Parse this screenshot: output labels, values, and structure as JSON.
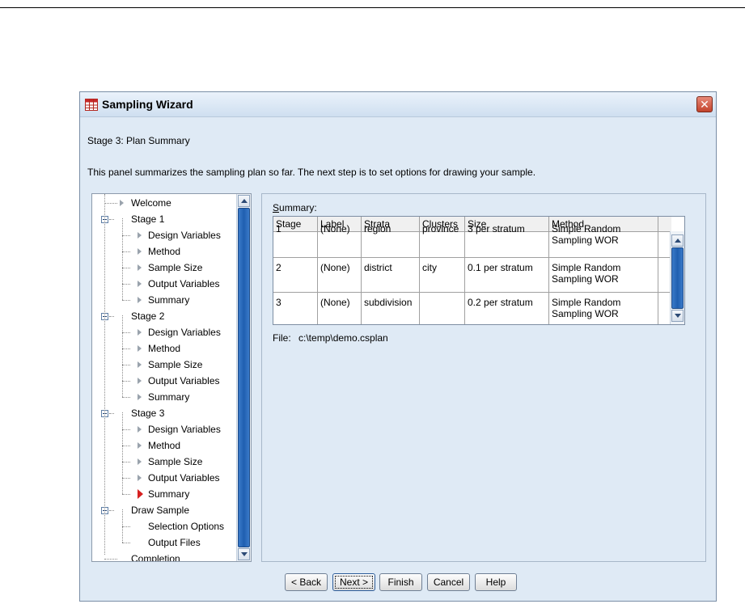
{
  "window": {
    "title": "Sampling Wizard",
    "close_glyph": "✕"
  },
  "stage_title": "Stage 3: Plan Summary",
  "description": "This panel summarizes the sampling plan so far. The next step is to set options for drawing your sample.",
  "tree": {
    "items": [
      {
        "label": "Welcome",
        "level": 0,
        "type": "arrow"
      },
      {
        "label": "Stage 1",
        "level": 0,
        "type": "expander"
      },
      {
        "label": "Design Variables",
        "level": 1,
        "type": "arrow"
      },
      {
        "label": "Method",
        "level": 1,
        "type": "arrow"
      },
      {
        "label": "Sample Size",
        "level": 1,
        "type": "arrow"
      },
      {
        "label": "Output Variables",
        "level": 1,
        "type": "arrow"
      },
      {
        "label": "Summary",
        "level": 1,
        "type": "arrow"
      },
      {
        "label": "Stage 2",
        "level": 0,
        "type": "expander"
      },
      {
        "label": "Design Variables",
        "level": 1,
        "type": "arrow"
      },
      {
        "label": "Method",
        "level": 1,
        "type": "arrow"
      },
      {
        "label": "Sample Size",
        "level": 1,
        "type": "arrow"
      },
      {
        "label": "Output Variables",
        "level": 1,
        "type": "arrow"
      },
      {
        "label": "Summary",
        "level": 1,
        "type": "arrow"
      },
      {
        "label": "Stage 3",
        "level": 0,
        "type": "expander"
      },
      {
        "label": "Design Variables",
        "level": 1,
        "type": "arrow"
      },
      {
        "label": "Method",
        "level": 1,
        "type": "arrow"
      },
      {
        "label": "Sample Size",
        "level": 1,
        "type": "arrow"
      },
      {
        "label": "Output Variables",
        "level": 1,
        "type": "arrow"
      },
      {
        "label": "Summary",
        "level": 1,
        "type": "current"
      },
      {
        "label": "Draw Sample",
        "level": 0,
        "type": "expander"
      },
      {
        "label": "Selection Options",
        "level": 1,
        "type": "none"
      },
      {
        "label": "Output Files",
        "level": 1,
        "type": "none"
      },
      {
        "label": "Completion",
        "level": 0,
        "type": "none"
      }
    ]
  },
  "summary": {
    "label_prefix": "S",
    "label_rest": "ummary:",
    "columns": [
      "Stage",
      "Label",
      "Strata",
      "Clusters",
      "Size",
      "Method"
    ],
    "rows": [
      [
        "1",
        "(None)",
        "region",
        "province",
        "3 per stratum",
        "Simple Random Sampling WOR"
      ],
      [
        "2",
        "(None)",
        "district",
        "city",
        "0.1 per stratum",
        "Simple Random Sampling WOR"
      ],
      [
        "3",
        "(None)",
        "subdivision",
        "",
        "0.2 per stratum",
        "Simple Random Sampling WOR"
      ]
    ]
  },
  "file": {
    "label": "File:",
    "path": "c:\\temp\\demo.csplan"
  },
  "buttons": {
    "back": "< Back",
    "next": "Next >",
    "finish": "Finish",
    "cancel": "Cancel",
    "help": "Help"
  },
  "colors": {
    "window_bg": "#dfeaf5",
    "current_marker": "#d62020",
    "scroll_thumb": "#1f5fb0"
  }
}
